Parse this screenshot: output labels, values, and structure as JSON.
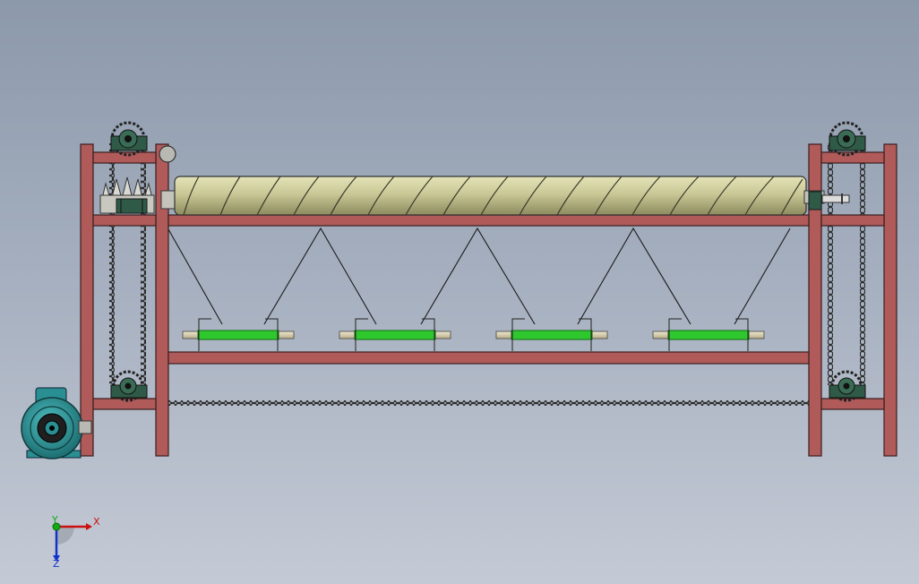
{
  "model": {
    "components": {
      "frame": "frame",
      "screw_conveyor": "screw-conveyor",
      "rollers": [
        "roller-1",
        "roller-2",
        "roller-3",
        "roller-4"
      ],
      "motor": "electric-motor",
      "sprockets": [
        "sprocket-top-left",
        "sprocket-top-right",
        "sprocket-bottom-left",
        "sprocket-bottom-right"
      ],
      "bevel_gear": "bevel-gear",
      "chains": [
        "drive-chain-bottom",
        "chain-left-vertical",
        "chain-right-vertical"
      ]
    }
  },
  "axis_triad": {
    "x_label": "X",
    "y_label": "Y",
    "z_label": "Z"
  },
  "colors": {
    "background_top": "#8c99ab",
    "background_bottom": "#c4cad5",
    "frame": "#b05a5a",
    "frame_edge": "#3a1f1f",
    "screw": "#c9c896",
    "roller_core": "#2ec82e",
    "shaft": "#d8cfb0",
    "motor": "#2a8f93",
    "bearing_block": "#2f5a48",
    "axis_x": "#cc1111",
    "axis_y": "#11aa11",
    "axis_z": "#1133cc"
  }
}
